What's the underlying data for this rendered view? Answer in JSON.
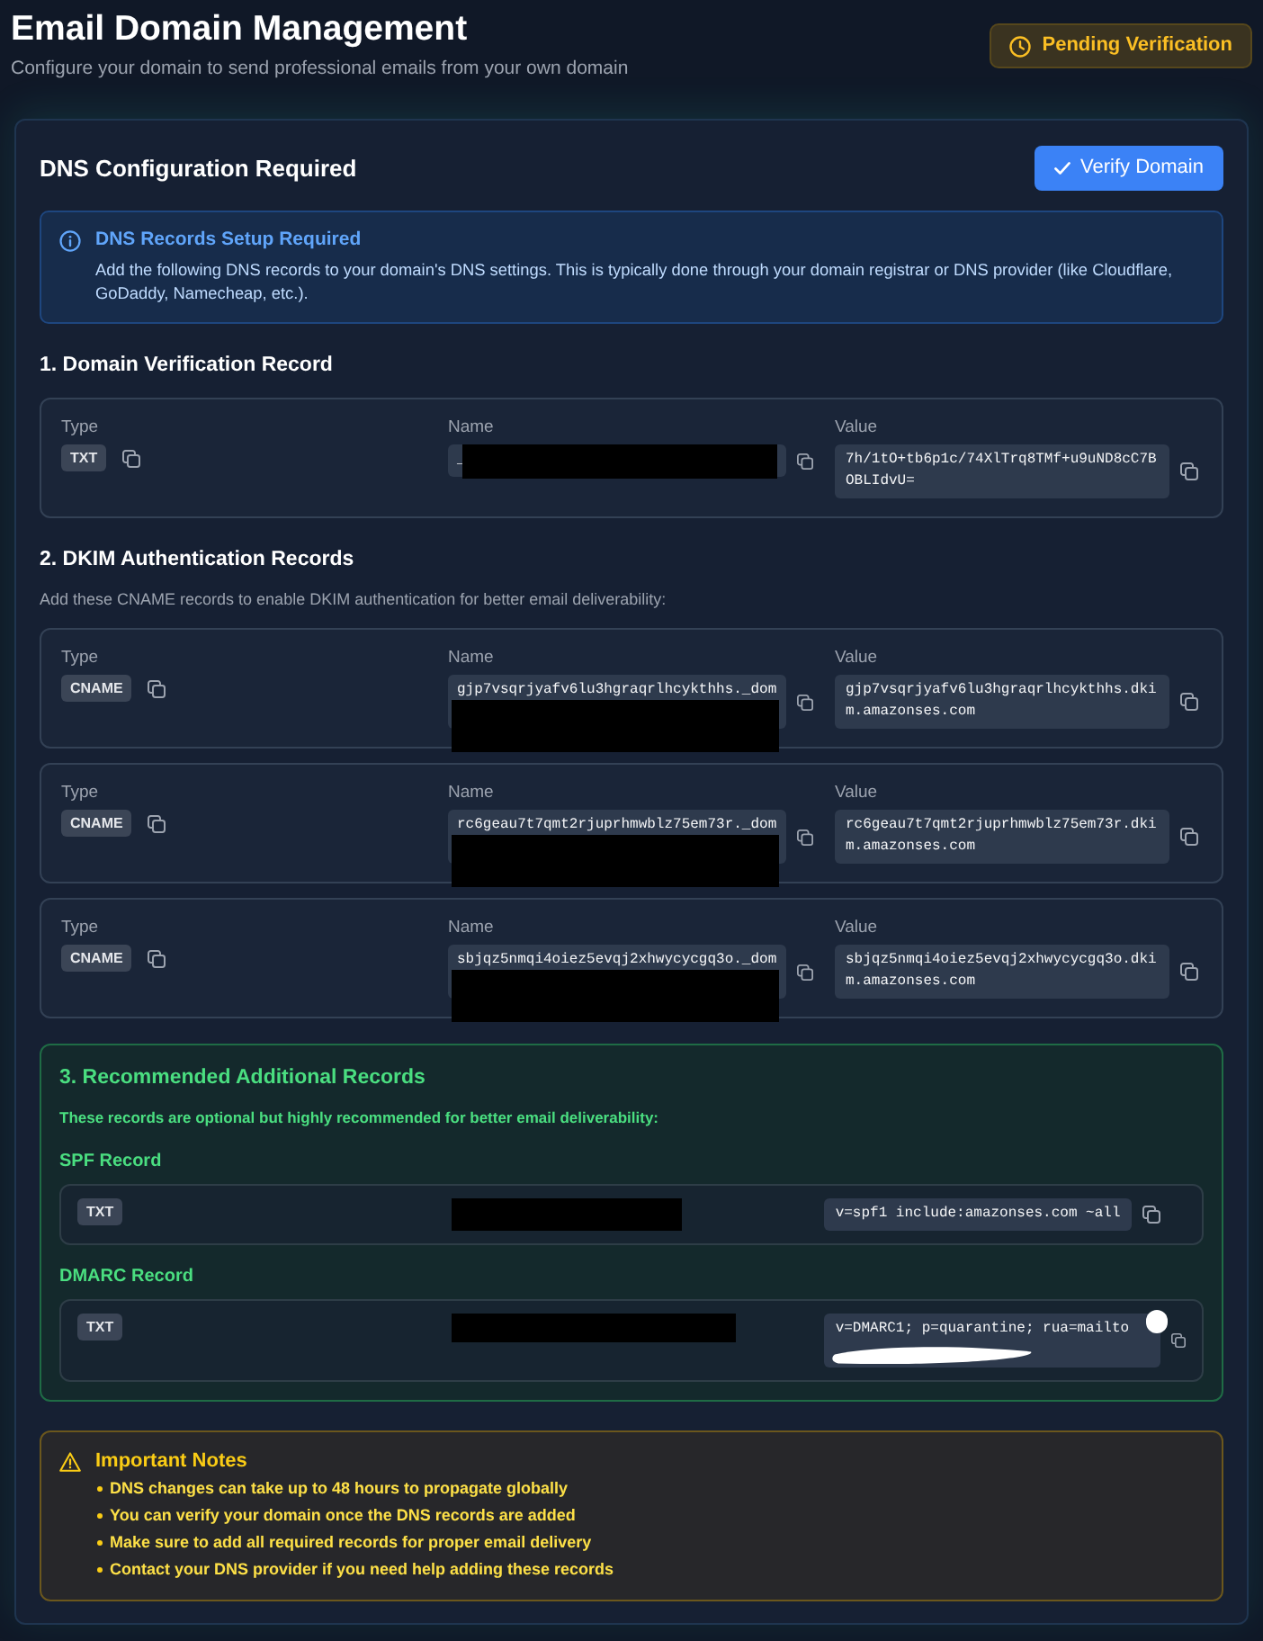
{
  "header": {
    "title": "Email Domain Management",
    "subtitle": "Configure your domain to send professional emails from your own domain",
    "status_badge": "Pending Verification"
  },
  "dns_card": {
    "title": "DNS Configuration Required",
    "verify_button": "Verify Domain",
    "info": {
      "title": "DNS Records Setup Required",
      "text": "Add the following DNS records to your domain's DNS settings. This is typically done through your domain registrar or DNS provider (like Cloudflare, GoDaddy, Namecheap, etc.)."
    }
  },
  "verification": {
    "title": "1. Domain Verification Record",
    "records": [
      {
        "type_label": "Type",
        "type": "TXT",
        "name_label": "Name",
        "name": "_",
        "name_redacted": true,
        "value_label": "Value",
        "value": "7h/1tO+tb6p1c/74XlTrq8TMf+u9uND8cC7BOBLIdvU="
      }
    ]
  },
  "dkim": {
    "title": "2. DKIM Authentication Records",
    "description": "Add these CNAME records to enable DKIM authentication for better email deliverability:",
    "records": [
      {
        "type_label": "Type",
        "type": "CNAME",
        "name_label": "Name",
        "name": "gjp7vsqrjyafv6lu3hgraqrlhcykthhs._dom",
        "name_redacted": true,
        "value_label": "Value",
        "value": "gjp7vsqrjyafv6lu3hgraqrlhcykthhs.dkim.amazonses.com"
      },
      {
        "type_label": "Type",
        "type": "CNAME",
        "name_label": "Name",
        "name": "rc6geau7t7qmt2rjuprhmwblz75em73r._dom",
        "name_redacted": true,
        "value_label": "Value",
        "value": "rc6geau7t7qmt2rjuprhmwblz75em73r.dkim.amazonses.com"
      },
      {
        "type_label": "Type",
        "type": "CNAME",
        "name_label": "Name",
        "name": "sbjqz5nmqi4oiez5evqj2xhwycycgq3o._dom",
        "name_redacted": true,
        "value_label": "Value",
        "value": "sbjqz5nmqi4oiez5evqj2xhwycycgq3o.dkim.amazonses.com"
      }
    ]
  },
  "recommended": {
    "title": "3. Recommended Additional Records",
    "description": "These records are optional but highly recommended for better email deliverability:",
    "records": [
      {
        "heading": "SPF Record",
        "type": "TXT",
        "name_redacted": true,
        "value": "v=spf1 include:amazonses.com ~all"
      },
      {
        "heading": "DMARC Record",
        "type": "TXT",
        "name_redacted": true,
        "value": "v=DMARC1; p=quarantine; rua=mailto",
        "value_redacted": true
      }
    ]
  },
  "notes": {
    "title": "Important Notes",
    "items": [
      "DNS changes can take up to 48 hours to propagate globally",
      "You can verify your domain once the DNS records are added",
      "Make sure to add all required records for proper email delivery",
      "Contact your DNS provider if you need help adding these records"
    ]
  }
}
